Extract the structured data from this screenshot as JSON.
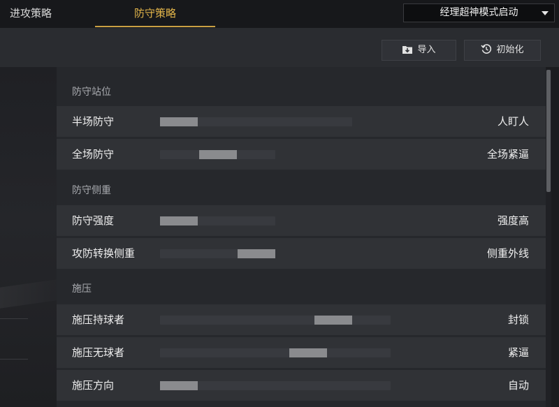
{
  "tabs": [
    {
      "label": "进攻策略",
      "active": false
    },
    {
      "label": "防守策略",
      "active": true
    }
  ],
  "mode_select": {
    "value": "经理超神模式启动"
  },
  "toolbar": {
    "import_label": "导入",
    "reset_label": "初始化"
  },
  "sections": [
    {
      "title": "防守站位",
      "rows": [
        {
          "label": "半场防守",
          "value": "人盯人",
          "level": 0.0
        },
        {
          "label": "全场防守",
          "value": "全场紧逼",
          "level": 0.5
        }
      ]
    },
    {
      "title": "防守侧重",
      "rows": [
        {
          "label": "防守强度",
          "value": "强度高",
          "level": 0.0
        },
        {
          "label": "攻防转换侧重",
          "value": "侧重外线",
          "level": 1.0
        }
      ]
    },
    {
      "title": "施压",
      "rows": [
        {
          "label": "施压持球者",
          "value": "封锁",
          "level": 0.8
        },
        {
          "label": "施压无球者",
          "value": "紧逼",
          "level": 0.67
        },
        {
          "label": "施压方向",
          "value": "自动",
          "level": 0.0
        }
      ]
    }
  ],
  "colors": {
    "accent": "#caa043",
    "knob": "#8a8b8e",
    "track": "#383a3f"
  }
}
